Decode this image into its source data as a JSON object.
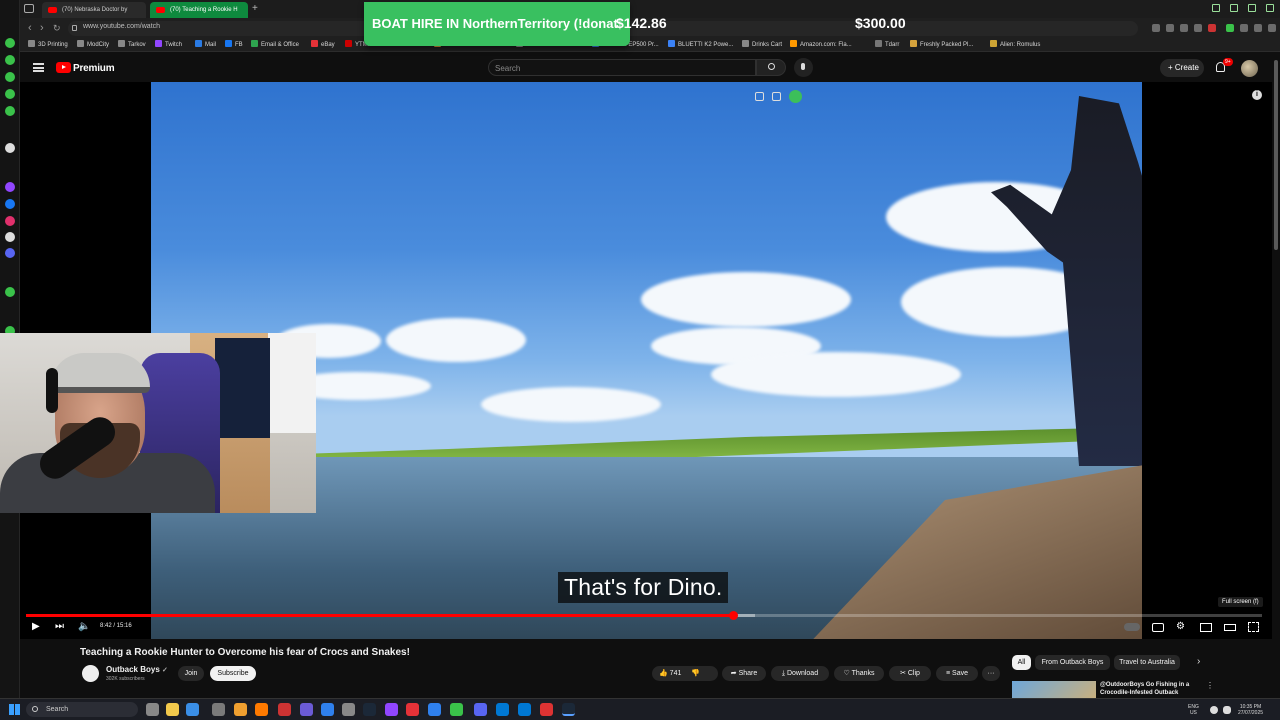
{
  "browser": {
    "tabs": [
      {
        "label": "(70) Nebraska Doctor by"
      },
      {
        "label": "(70) Teaching a Rookie H"
      }
    ],
    "url": "www.youtube.com/watch"
  },
  "bookmarks": [
    {
      "label": "3D Printing",
      "color": "#888888"
    },
    {
      "label": "ModCity",
      "color": "#888888"
    },
    {
      "label": "Tarkov",
      "color": "#888888"
    },
    {
      "label": "Twitch",
      "color": "#9146ff"
    },
    {
      "label": "Mail",
      "color": "#2a7be4"
    },
    {
      "label": "FB",
      "color": "#1877f2"
    },
    {
      "label": "Email & Office",
      "color": "#2ea44f"
    },
    {
      "label": "eBay",
      "color": "#e53238"
    },
    {
      "label": "YTMP3 - Youtub...",
      "color": "#cc0000"
    },
    {
      "label": "350W Amber AUS...",
      "color": "#e6a23c"
    },
    {
      "label": "Goal Zero Australi...",
      "color": "#999999"
    },
    {
      "label": "BLUETTI EP500 Pr...",
      "color": "#3b82f6"
    },
    {
      "label": "BLUETTI K2 Powe...",
      "color": "#3b82f6"
    },
    {
      "label": "Drinks Cart",
      "color": "#888888"
    },
    {
      "label": "Amazon.com: Fla...",
      "color": "#ff9900"
    },
    {
      "label": "Tdarr",
      "color": "#777777"
    },
    {
      "label": "Freshly Packed Pl...",
      "color": "#d4a23c"
    },
    {
      "label": "Alien: Romulus",
      "color": "#cda434"
    }
  ],
  "donation": {
    "message": "BOAT HIRE IN NorthernTerritory (!donat",
    "amount_raised": "$142.86",
    "goal": "$300.00",
    "color": "#39c060"
  },
  "youtube": {
    "logo_text": "Premium",
    "search_placeholder": "Search",
    "create_label": "Create",
    "notification_count": "9+",
    "player": {
      "caption": "That's for Dino.",
      "time": "8:42 / 15:16",
      "fullscreen_tooltip": "Full screen (f)",
      "progress_fraction": 0.572,
      "buffered_fraction": 0.59
    },
    "video": {
      "title": "Teaching a Rookie Hunter to Overcome his fear of Crocs and Snakes!",
      "channel": "Outback Boys",
      "subscribers": "302K subscribers",
      "join_label": "Join",
      "subscribe_label": "Subscribe",
      "likes": "741",
      "share_label": "Share",
      "download_label": "Download",
      "thanks_label": "Thanks",
      "clip_label": "Clip",
      "save_label": "Save"
    },
    "chips": [
      "All",
      "From Outback Boys",
      "Travel to Australia"
    ],
    "recommendation_title": "@OutdoorBoys Go Fishing in a Crocodile-Infested Outback"
  },
  "taskbar": {
    "search_placeholder": "Search",
    "lang": "ENG",
    "region": "US",
    "time": "10:35 PM",
    "date": "27/07/2025"
  }
}
